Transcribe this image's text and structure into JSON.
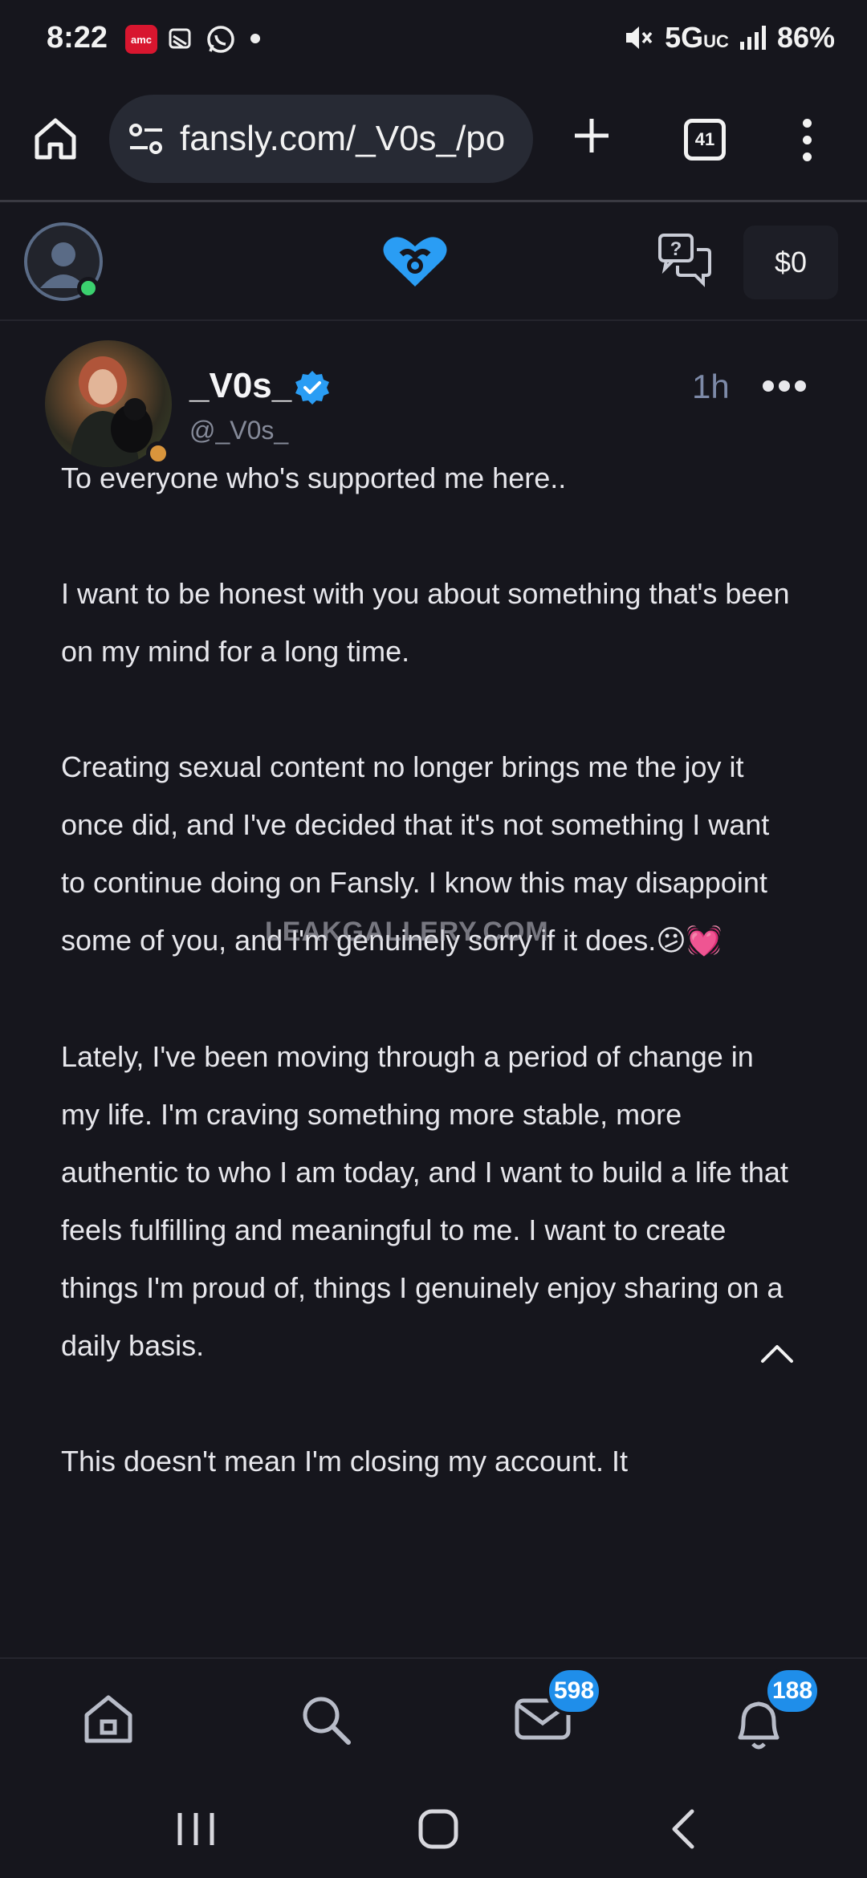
{
  "status_bar": {
    "time": "8:22",
    "network": "5G",
    "network_suffix": "UC",
    "battery": "86%"
  },
  "browser": {
    "url": "fansly.com/_V0s_/po",
    "tab_count": "41"
  },
  "header": {
    "balance": "$0"
  },
  "post": {
    "display_name": "_V0s_",
    "handle": "@_V0s_",
    "time_ago": "1h",
    "paragraphs": [
      "To everyone who's supported me here..",
      "I want to be honest with you about something that's been on my mind for a long time.",
      "Creating sexual content no longer brings me the joy it once did, and I've decided that it's not something I want to continue doing on Fansly. I know this may disappoint some of you, and I'm genuinely sorry if it does.",
      "Lately, I've been moving through a period of change in my life. I'm craving something more stable, more authentic to who I am today, and I want to build a life that feels fulfilling and meaningful to me. I want to create things I'm proud of, things I genuinely enjoy sharing on a daily basis.",
      "This doesn't mean I'm closing my account. It"
    ],
    "emojis": "😕💓",
    "watermark": "LEAKGALLERY.COM"
  },
  "bottom_nav": {
    "messages_badge": "598",
    "notifications_badge": "188"
  },
  "colors": {
    "background": "#16161d",
    "accent_blue": "#1f8eea",
    "logo_blue": "#2a9df4",
    "online_green": "#3bd16f"
  }
}
